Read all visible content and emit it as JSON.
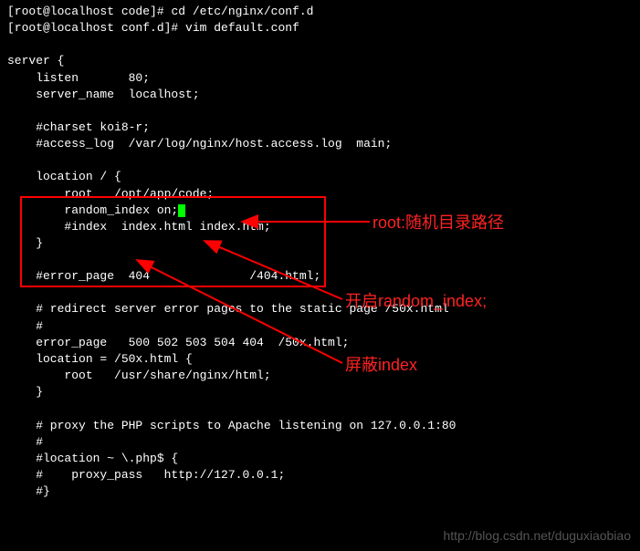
{
  "prompt1": "[root@localhost code]# ",
  "cmd1": "cd /etc/nginx/conf.d",
  "prompt2": "[root@localhost conf.d]# ",
  "cmd2": "vim default.conf",
  "config": {
    "l1": "server {",
    "l2": "    listen       80;",
    "l3": "    server_name  localhost;",
    "l4": "",
    "l5": "    #charset koi8-r;",
    "l6": "    #access_log  /var/log/nginx/host.access.log  main;",
    "l7": "",
    "l8": "    location / {",
    "l9": "        root   /opt/app/code;",
    "l10a": "        random_index on;",
    "l11": "        #index  index.html index.htm;",
    "l12": "    }",
    "l13": "",
    "l14": "    #error_page  404              /404.html;",
    "l15": "",
    "l16": "    # redirect server error pages to the static page /50x.html",
    "l17": "    #",
    "l18": "    error_page   500 502 503 504 404  /50x.html;",
    "l19": "    location = /50x.html {",
    "l20": "        root   /usr/share/nginx/html;",
    "l21": "    }",
    "l22": "",
    "l23": "    # proxy the PHP scripts to Apache listening on 127.0.0.1:80",
    "l24": "    #",
    "l25": "    #location ~ \\.php$ {",
    "l26": "    #    proxy_pass   http://127.0.0.1;",
    "l27": "    #}"
  },
  "annotations": {
    "a1": "root:随机目录路径",
    "a2": "开启random_index;",
    "a3": "屏蔽index"
  },
  "watermark": "http://blog.csdn.net/duguxiaobiao"
}
